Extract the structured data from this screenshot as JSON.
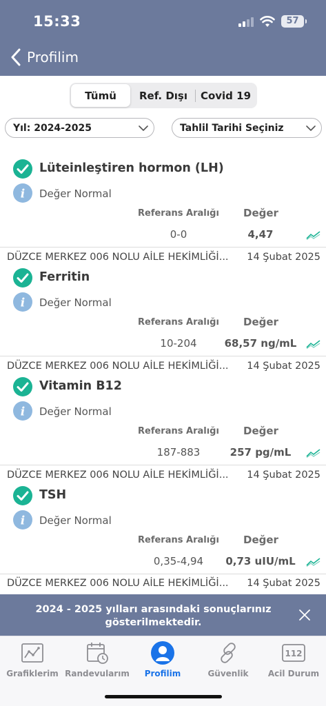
{
  "status_bar": {
    "time": "15:33",
    "battery": "57"
  },
  "nav": {
    "title": "Profilim"
  },
  "segments": [
    {
      "label": "Tümü",
      "active": true
    },
    {
      "label": "Ref. Dışı",
      "active": false
    },
    {
      "label": "Covid 19",
      "active": false
    }
  ],
  "filters": {
    "year": "Yıl: 2024-2025",
    "date": "Tahlil Tarihi Seçiniz"
  },
  "columns": {
    "ref_range": "Referans Aralığı",
    "value": "Değer"
  },
  "results": [
    {
      "clinic": "",
      "date": "",
      "name": "Lüteinleştiren hormon (LH)",
      "status": "Değer Normal",
      "ref_range": "0-0",
      "value": "4,47"
    },
    {
      "clinic": "DÜZCE MERKEZ 006 NOLU AİLE HEKİMLİĞİ...",
      "date": "14 Şubat 2025",
      "name": "Ferritin",
      "status": "Değer Normal",
      "ref_range": "10-204",
      "value": "68,57 ng/mL"
    },
    {
      "clinic": "DÜZCE MERKEZ 006 NOLU AİLE HEKİMLİĞİ...",
      "date": "14 Şubat 2025",
      "name": "Vitamin B12",
      "status": "Değer Normal",
      "ref_range": "187-883",
      "value": "257 pg/mL"
    },
    {
      "clinic": "DÜZCE MERKEZ 006 NOLU AİLE HEKİMLİĞİ...",
      "date": "14 Şubat 2025",
      "name": "TSH",
      "status": "Değer Normal",
      "ref_range": "0,35-4,94",
      "value": "0,73 uIU/mL"
    }
  ],
  "next_partial": {
    "clinic": "DÜZCE MERKEZ 006 NOLU AİLE HEKİMLİĞİ...",
    "date": "14 Şubat 2025"
  },
  "banner": {
    "text": "2024 - 2025 yılları arasındaki sonuçlarınız gösterilmektedir."
  },
  "tabs": [
    {
      "label": "Grafiklerim",
      "icon": "chart-icon",
      "active": false
    },
    {
      "label": "Randevularım",
      "icon": "calendar-icon",
      "active": false
    },
    {
      "label": "Profilim",
      "icon": "profile-icon",
      "active": true
    },
    {
      "label": "Güvenlik",
      "icon": "link-icon",
      "active": false
    },
    {
      "label": "Acil Durum",
      "icon": "emergency-112-icon",
      "active": false
    }
  ],
  "tab_icon_text": {
    "emergency": "112"
  },
  "colors": {
    "header": "#6c7a9c",
    "check": "#1bb394",
    "info": "#8fb8df",
    "active_tab": "#1a73e8",
    "inactive_tab": "#8d8d92"
  }
}
